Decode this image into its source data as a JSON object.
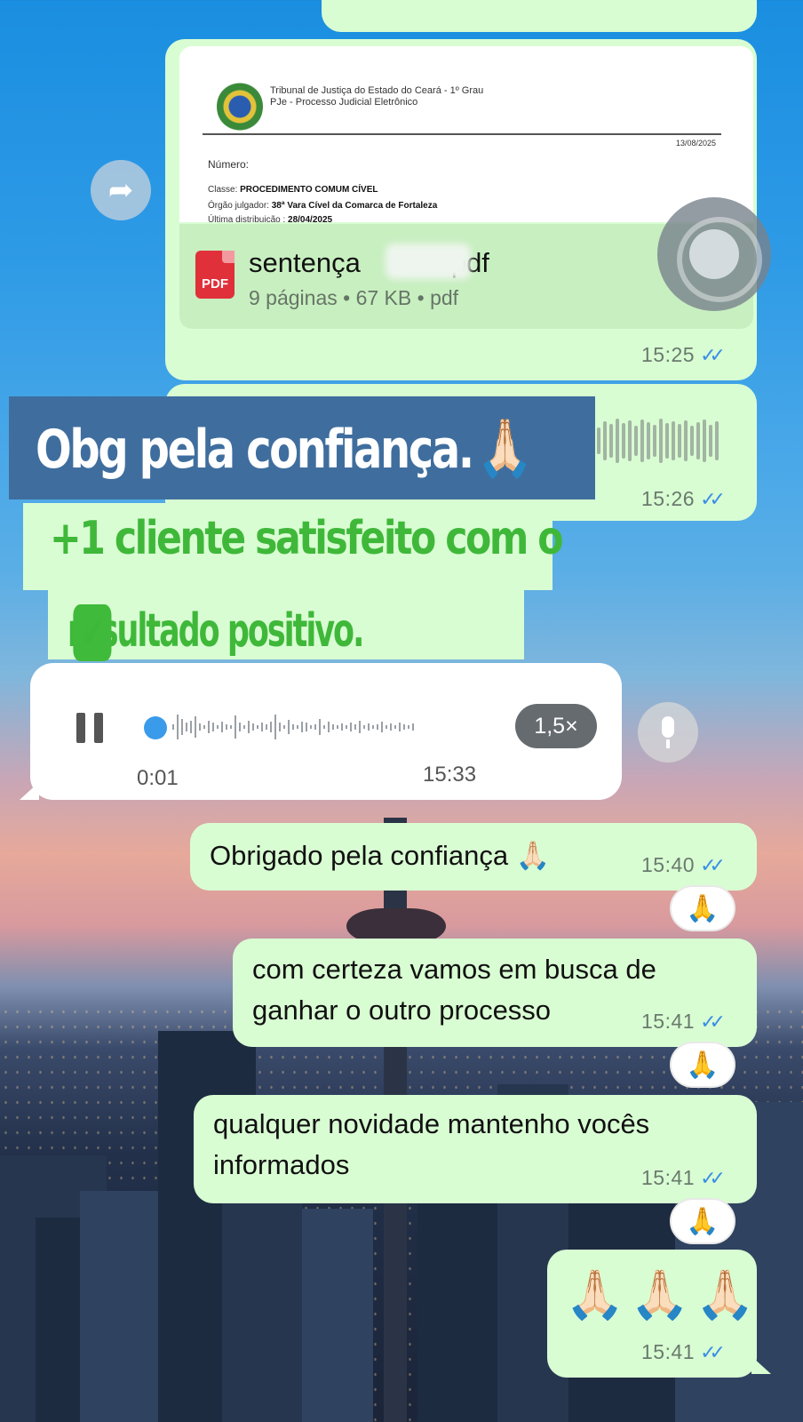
{
  "doc": {
    "court_line1": "Tribunal de Justiça do Estado do Ceará - 1º Grau",
    "court_line2": "PJe - Processo Judicial Eletrônico",
    "date": "13/08/2025",
    "numero_label": "Número: ",
    "classe_label": "Classe: ",
    "classe_value": "PROCEDIMENTO COMUM CÍVEL",
    "orgao_label": "Órgão julgador: ",
    "orgao_value": "38ª Vara Cível da Comarca de Fortaleza",
    "distrib_label": "Última distribuição : ",
    "distrib_value": "28/04/2025"
  },
  "file": {
    "name_prefix": "sentença",
    "name_suffix": "pdf",
    "meta": "9 páginas • 67 KB • pdf",
    "icon_label": "PDF",
    "time": "15:25"
  },
  "overlay": {
    "line1": "Obg pela confiança.",
    "line1_emoji": "🙏🏻",
    "line2": "+1 cliente satisfeito com o",
    "line3": "resultado positivo.",
    "check": "✔"
  },
  "voice_out": {
    "time": "15:26"
  },
  "audio": {
    "elapsed": "0:01",
    "time": "15:33",
    "speed": "1,5×"
  },
  "messages": [
    {
      "text": "Obrigado pela confiança 🙏🏻",
      "time": "15:40"
    },
    {
      "text": "com certeza vamos em busca de ganhar o outro processo",
      "time": "15:41"
    },
    {
      "text": "qualquer novidade mantenho vocês informados",
      "time": "15:41"
    },
    {
      "text": "🙏🏻🙏🏻🙏🏻",
      "time": "15:41"
    }
  ],
  "reaction": "🙏",
  "colors": {
    "bubble_out": "#d9fdd3",
    "bubble_in": "#ffffff",
    "tick": "#3a8ee6",
    "overlay_blue": "#3f6e9e",
    "overlay_green_text": "#3fb83a"
  }
}
